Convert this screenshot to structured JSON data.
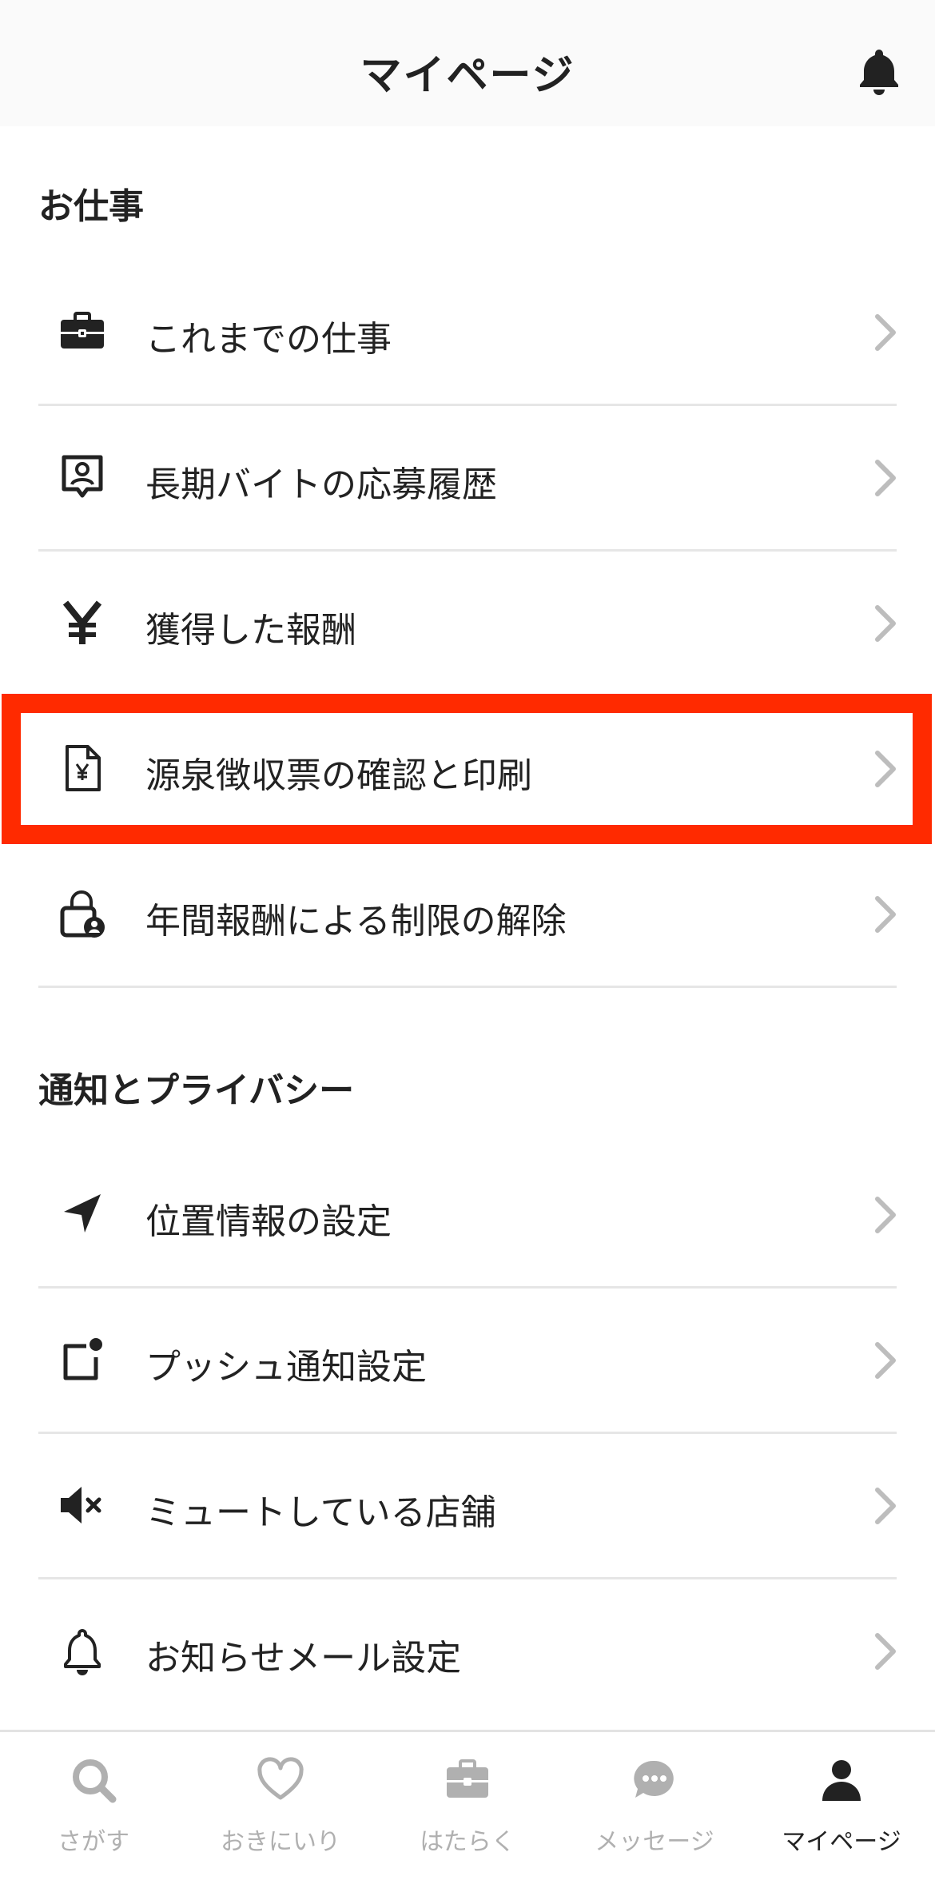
{
  "header": {
    "title": "マイページ",
    "bell_icon": "bell-icon"
  },
  "sections": [
    {
      "title": "お仕事",
      "items": [
        {
          "label": "これまでの仕事",
          "icon": "briefcase-icon"
        },
        {
          "label": "長期バイトの応募履歴",
          "icon": "profile-card-icon"
        },
        {
          "label": "獲得した報酬",
          "icon": "yen-icon"
        },
        {
          "label": "源泉徴収票の確認と印刷",
          "icon": "yen-document-icon",
          "highlighted": true
        },
        {
          "label": "年間報酬による制限の解除",
          "icon": "unlock-user-icon"
        }
      ]
    },
    {
      "title": "通知とプライバシー",
      "items": [
        {
          "label": "位置情報の設定",
          "icon": "location-arrow-icon"
        },
        {
          "label": "プッシュ通知設定",
          "icon": "push-notification-icon"
        },
        {
          "label": "ミュートしている店舗",
          "icon": "mute-speaker-icon"
        },
        {
          "label": "お知らせメール設定",
          "icon": "bell-icon"
        }
      ]
    }
  ],
  "tabbar": [
    {
      "label": "さがす",
      "icon": "search-icon",
      "active": false
    },
    {
      "label": "おきにいり",
      "icon": "heart-icon",
      "active": false
    },
    {
      "label": "はたらく",
      "icon": "briefcase-icon",
      "active": false
    },
    {
      "label": "メッセージ",
      "icon": "chat-bubble-icon",
      "active": false
    },
    {
      "label": "マイページ",
      "icon": "person-icon",
      "active": true
    }
  ],
  "colors": {
    "highlight": "#ff2a00",
    "text": "#222222",
    "inactive": "#b0b0b0",
    "divider": "#e6e6e6"
  }
}
